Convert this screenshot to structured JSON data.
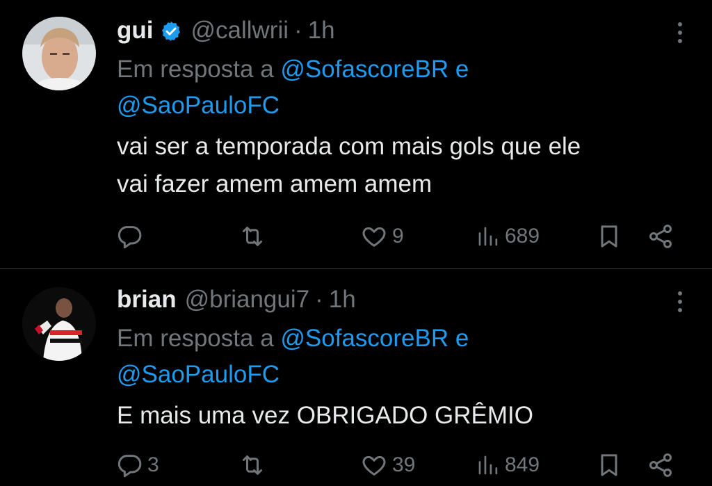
{
  "tweets": [
    {
      "name": "gui",
      "verified": true,
      "handle": "@callwrii",
      "separator": "·",
      "time": "1h",
      "reply_prefix": "Em resposta a",
      "mention1": "@SofascoreBR",
      "reply_conj": "e",
      "mention2": "@SaoPauloFC",
      "text_line1": "vai ser a temporada com mais gols que ele",
      "text_line2": "vai fazer amem amem amem",
      "replies": "",
      "reposts": "",
      "likes": "9",
      "views": "689"
    },
    {
      "name": "brian",
      "verified": false,
      "handle": "@briangui7",
      "separator": "·",
      "time": "1h",
      "reply_prefix": "Em resposta a",
      "mention1": "@SofascoreBR",
      "reply_conj": "e",
      "mention2": "@SaoPauloFC",
      "text_line1": "E mais uma vez OBRIGADO GRÊMIO",
      "replies": "3",
      "reposts": "",
      "likes": "39",
      "views": "849"
    }
  ],
  "colors": {
    "background": "#000000",
    "text": "#e7e9ea",
    "muted": "#71767b",
    "link": "#1d9bf0",
    "verified": "#1d9bf0",
    "divider": "#2f3336"
  },
  "icons": [
    "more-icon",
    "reply-icon",
    "repost-icon",
    "like-icon",
    "views-icon",
    "bookmark-icon",
    "share-icon",
    "verified-badge-icon"
  ]
}
